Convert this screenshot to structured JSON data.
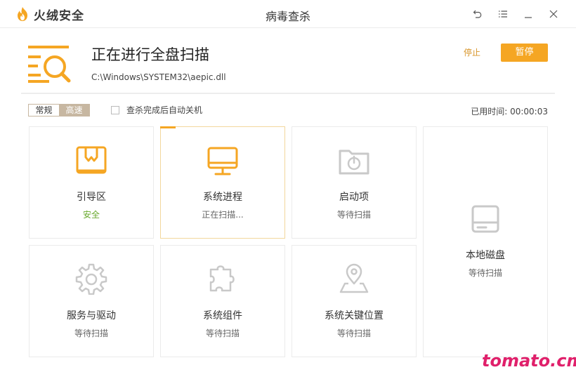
{
  "app": {
    "name": "火绒安全",
    "window_title": "病毒查杀",
    "accent_color": "#f5a623"
  },
  "window_controls": {
    "icons": [
      "back-icon",
      "menu-icon",
      "minimize-icon",
      "close-icon"
    ]
  },
  "scan": {
    "title": "正在进行全盘扫描",
    "current_path": "C:\\Windows\\SYSTEM32\\aepic.dll",
    "stop_label": "停止",
    "pause_label": "暂停"
  },
  "options": {
    "mode_normal": "常规",
    "mode_fast": "高速",
    "mode_selected": "高速",
    "auto_shutdown_label": "查杀完成后自动关机",
    "auto_shutdown_checked": false,
    "elapsed_label": "已用时间:",
    "elapsed_value": "00:00:03"
  },
  "items": [
    {
      "name": "引导区",
      "status": "安全",
      "icon": "boot-sector-icon",
      "state": "safe"
    },
    {
      "name": "系统进程",
      "status": "正在扫描...",
      "icon": "monitor-icon",
      "state": "scanning"
    },
    {
      "name": "启动项",
      "status": "等待扫描",
      "icon": "startup-icon",
      "state": "waiting"
    },
    {
      "name": "本地磁盘",
      "status": "等待扫描",
      "icon": "disk-icon",
      "state": "waiting"
    },
    {
      "name": "服务与驱动",
      "status": "等待扫描",
      "icon": "gear-icon",
      "state": "waiting"
    },
    {
      "name": "系统组件",
      "status": "等待扫描",
      "icon": "puzzle-icon",
      "state": "waiting"
    },
    {
      "name": "系统关键位置",
      "status": "等待扫描",
      "icon": "location-pin-icon",
      "state": "waiting"
    }
  ],
  "watermark": "tomato.cm"
}
